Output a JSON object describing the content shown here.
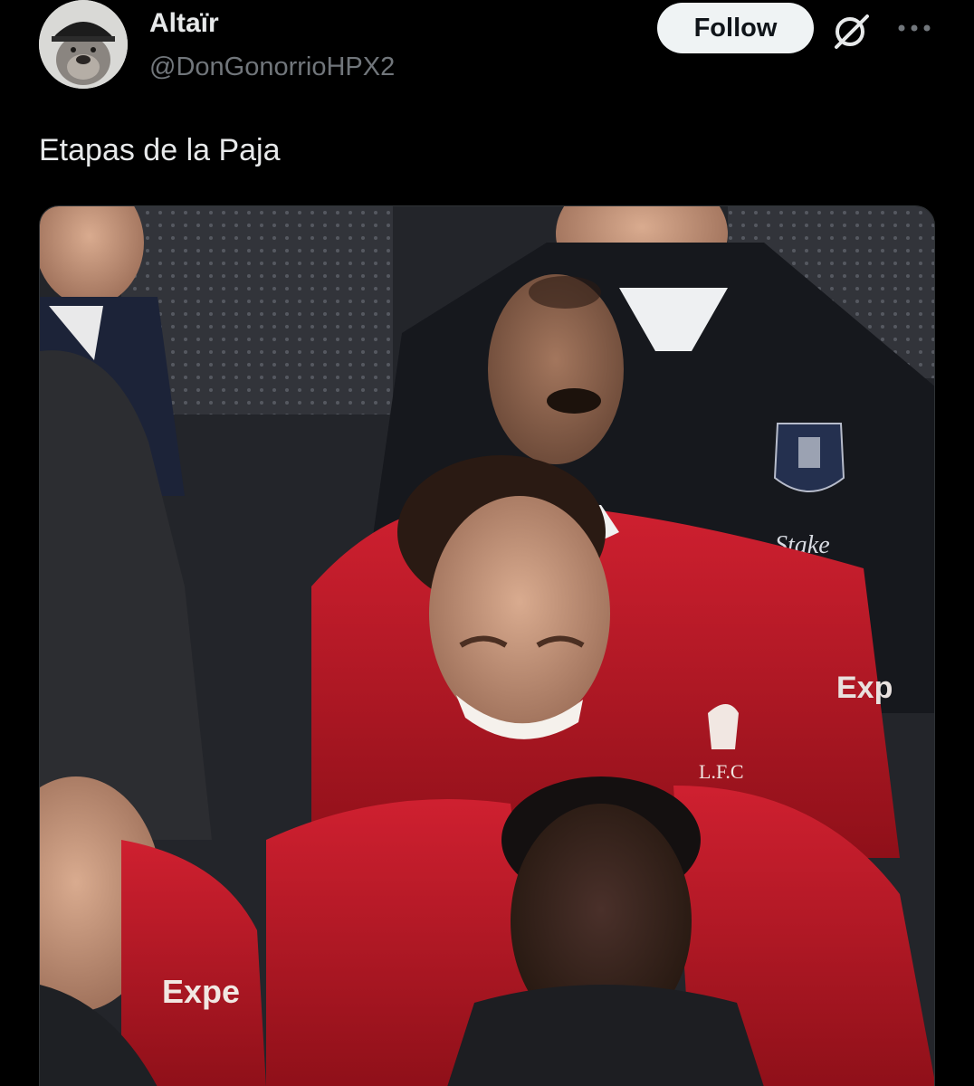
{
  "author": {
    "display_name": "Altaïr",
    "handle": "@DonGonorrioHPX2",
    "avatar_icon": "bulldog-with-cap-avatar"
  },
  "actions": {
    "follow_label": "Follow",
    "grok_icon": "grok-icon",
    "more_icon": "more-icon"
  },
  "tweet": {
    "text": "Etapas de la Paja"
  },
  "media": {
    "jersey_texts": [
      "Stake",
      "Exp",
      "L.F.C",
      "Expe"
    ]
  },
  "colors": {
    "background": "#000000",
    "text_primary": "#e7e9ea",
    "text_secondary": "#71767b",
    "follow_bg": "#eff3f4",
    "jersey_red": "#c8102e"
  }
}
